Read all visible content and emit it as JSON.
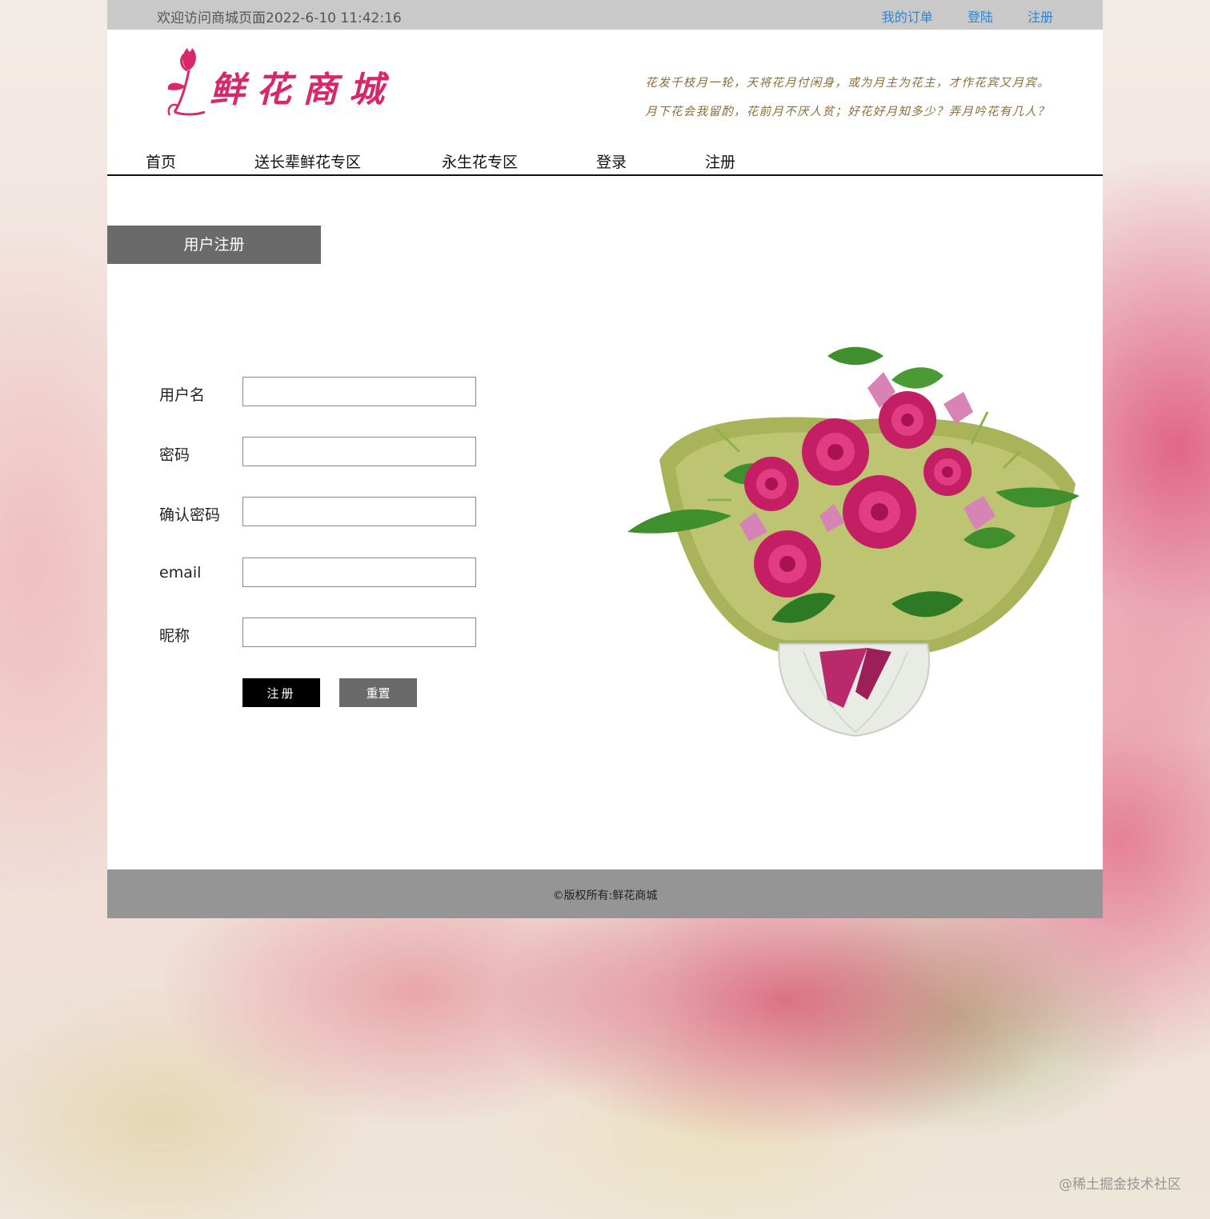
{
  "topbar": {
    "welcome": "欢迎访问商城页面2022-6-10 11:42:16",
    "links": [
      "我的订单",
      "登陆",
      "注册"
    ]
  },
  "header": {
    "logo_text": "鲜花商城",
    "poem": [
      "花发千枝月一轮，天将花月付闲身，或为月主为花主，才作花宾又月宾。",
      "月下花会我留酌，花前月不厌人贫；好花好月知多少？弄月吟花有几人？"
    ]
  },
  "nav": {
    "items": [
      "首页",
      "送长辈鲜花专区",
      "永生花专区",
      "登录",
      "注册"
    ]
  },
  "register": {
    "title": "用户注册",
    "fields": [
      {
        "label": "用户名",
        "value": "",
        "placeholder": ""
      },
      {
        "label": "密码",
        "value": "",
        "placeholder": ""
      },
      {
        "label": "确认密码",
        "value": "",
        "placeholder": ""
      },
      {
        "label": "email",
        "value": "",
        "placeholder": ""
      },
      {
        "label": "昵称",
        "value": "",
        "placeholder": ""
      }
    ],
    "submit_label": "注册",
    "reset_label": "重置"
  },
  "footer": {
    "copyright": "©版权所有:鲜花商城"
  },
  "watermark": "@稀土掘金技术社区",
  "colors": {
    "topbar_bg": "#c9c9c9",
    "link": "#2f83d6",
    "logo": "#d6286a",
    "title_bg": "#6a6a6a",
    "footer_bg": "#959595"
  }
}
